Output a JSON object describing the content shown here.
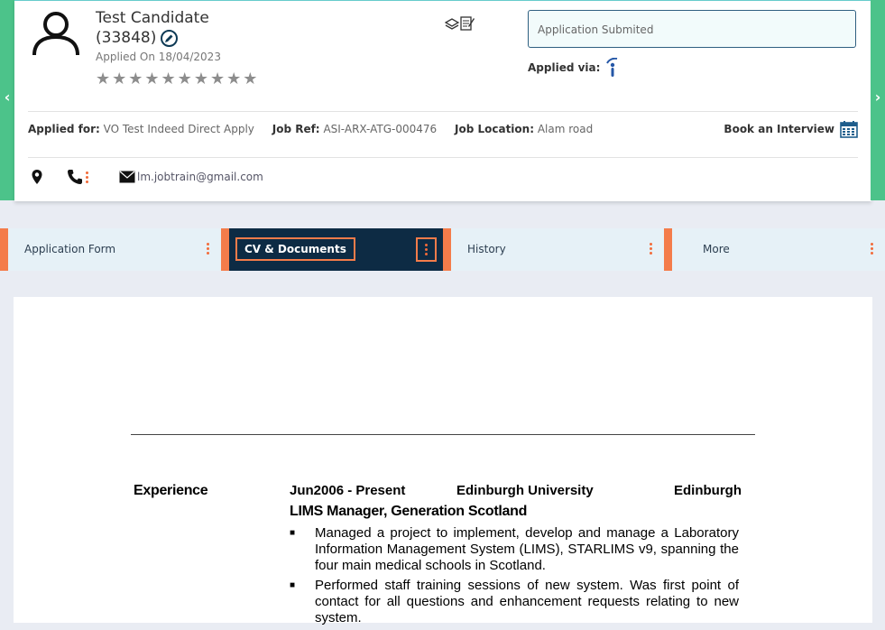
{
  "candidate": {
    "name": "Test Candidate",
    "id": "(33848)",
    "applied_on": "Applied On 18/04/2023",
    "rating_stars": "★★★★★★★★★★"
  },
  "status": {
    "value": "Application Submited"
  },
  "applied_via_label": "Applied via:",
  "job_info": {
    "applied_for_label": "Applied for:",
    "applied_for_value": "VO Test Indeed Direct Apply",
    "job_ref_label": "Job Ref:",
    "job_ref_value": "ASI-ARX-ATG-000476",
    "job_location_label": "Job Location:",
    "job_location_value": "Alam road"
  },
  "book_interview_label": "Book an Interview",
  "contact": {
    "email": "lm.jobtrain@gmail.com"
  },
  "tabs": [
    {
      "label": "Application Form"
    },
    {
      "label": "CV & Documents"
    },
    {
      "label": "History"
    },
    {
      "label": "More"
    }
  ],
  "cv": {
    "section_heading": "Experience",
    "job": {
      "dates": "Jun2006 - Present",
      "employer": "Edinburgh University",
      "location": "Edinburgh",
      "title": "LIMS Manager, Generation Scotland",
      "bullets": [
        "Managed a project to implement, develop and manage a Laboratory Information Management System (LIMS), STARLIMS v9, spanning the four main medical schools in Scotland.",
        "Performed staff training sessions of new system.  Was first point of contact for all questions and enhancement requests relating to new system."
      ]
    }
  },
  "icons": {
    "prev": "chevron-left-icon",
    "next": "chevron-right-icon",
    "avatar": "user-icon",
    "edit": "pencil-icon",
    "docs": "documents-icon",
    "indeed": "indeed-icon",
    "calendar": "calendar-icon",
    "pin": "map-pin-icon",
    "phone": "phone-icon",
    "mail": "mail-icon"
  },
  "colors": {
    "accent_green": "#4cc38a",
    "tab_accent": "#f47c4a",
    "active_tab_bg": "#0d2b44",
    "tab_bg": "#e6f1f7",
    "indeed_blue": "#2557a7"
  }
}
